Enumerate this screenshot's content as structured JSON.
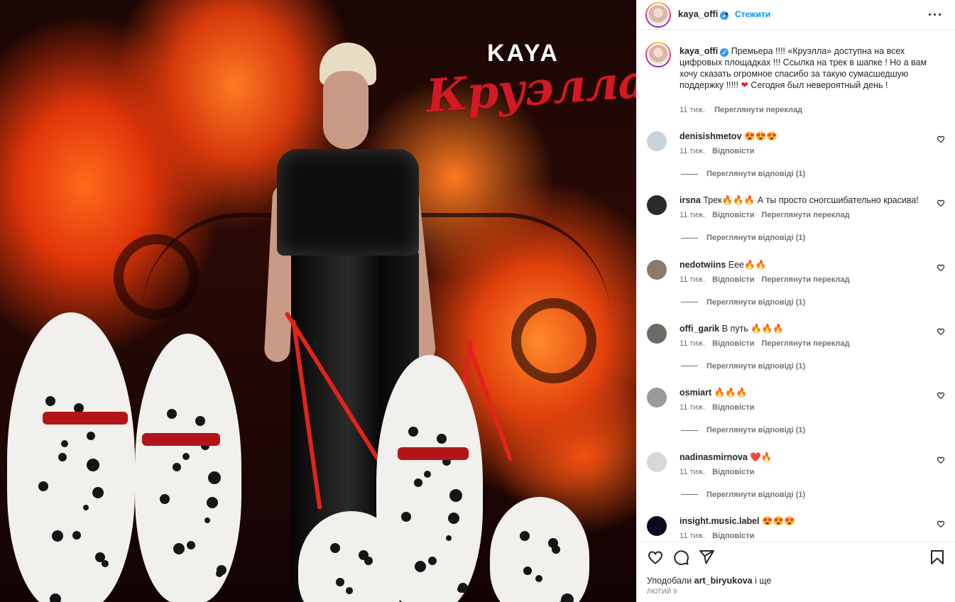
{
  "post_image": {
    "artist": "KAYA",
    "title": "Круэлла"
  },
  "header": {
    "username": "kaya_offi",
    "verified_mark": "✓",
    "separator": "•",
    "follow_label": "Стежити"
  },
  "caption": {
    "username": "kaya_offi",
    "text_part1": "Премьера !!!! «Круэлла» доступна на всех цифровых площадках !!! Ссылка на трек в шапке ! Но а вам хочу сказать огромное спасибо за такую сумасшедшую поддержку !!!!! ",
    "heart": "❤",
    "text_part2": " Сегодня был невероятный день !",
    "time": "11 тиж.",
    "translate": "Переглянути переклад"
  },
  "comments": [
    {
      "username": "denisishmetov",
      "text": "😍😍😍",
      "time": "11 тиж.",
      "reply": "Відповісти",
      "translate": "",
      "replies": "Переглянути відповіді (1)",
      "avatar_color": "#c9d3da"
    },
    {
      "username": "irsna",
      "text": "Трек🔥🔥🔥 А ты просто сногсшибательно красива!",
      "time": "11 тиж.",
      "reply": "Відповісти",
      "translate": "Переглянути переклад",
      "replies": "Переглянути відповіді (1)",
      "avatar_color": "#2b2b2b"
    },
    {
      "username": "nedotwiins",
      "text": "Еее🔥🔥",
      "time": "11 тиж.",
      "reply": "Відповісти",
      "translate": "Переглянути переклад",
      "replies": "Переглянути відповіді (1)",
      "avatar_color": "#8a7a6e"
    },
    {
      "username": "offi_garik",
      "text": "В путь 🔥🔥🔥",
      "time": "11 тиж.",
      "reply": "Відповісти",
      "translate": "Переглянути переклад",
      "replies": "Переглянути відповіді (1)",
      "avatar_color": "#6e6a66"
    },
    {
      "username": "osmiart",
      "text": "🔥🔥🔥",
      "time": "11 тиж.",
      "reply": "Відповісти",
      "translate": "",
      "replies": "Переглянути відповіді (1)",
      "avatar_color": "#9a9a9a"
    },
    {
      "username": "nadinasmirnova",
      "text": "❤️🔥",
      "time": "11 тиж.",
      "reply": "Відповісти",
      "translate": "",
      "replies": "Переглянути відповіді (1)",
      "avatar_color": "#d8d8d8"
    },
    {
      "username": "insight.music.label",
      "text": "😍😍😍",
      "time": "11 тиж.",
      "reply": "Відповісти",
      "translate": "",
      "replies": "",
      "avatar_color": "#0b0b1f"
    }
  ],
  "footer": {
    "liked_by_prefix": "Уподобали ",
    "liked_by_user": "art_biryukova",
    "liked_by_suffix": " і ще",
    "date": "ЛЮТИЙ 9"
  },
  "icons": {
    "like": "heart-icon",
    "comment": "comment-icon",
    "share": "share-icon",
    "save": "bookmark-icon",
    "more": "more-icon"
  },
  "colors": {
    "accent": "#0095f6",
    "verified": "#3897f0",
    "muted": "#737373",
    "title_red": "#d11a24"
  }
}
